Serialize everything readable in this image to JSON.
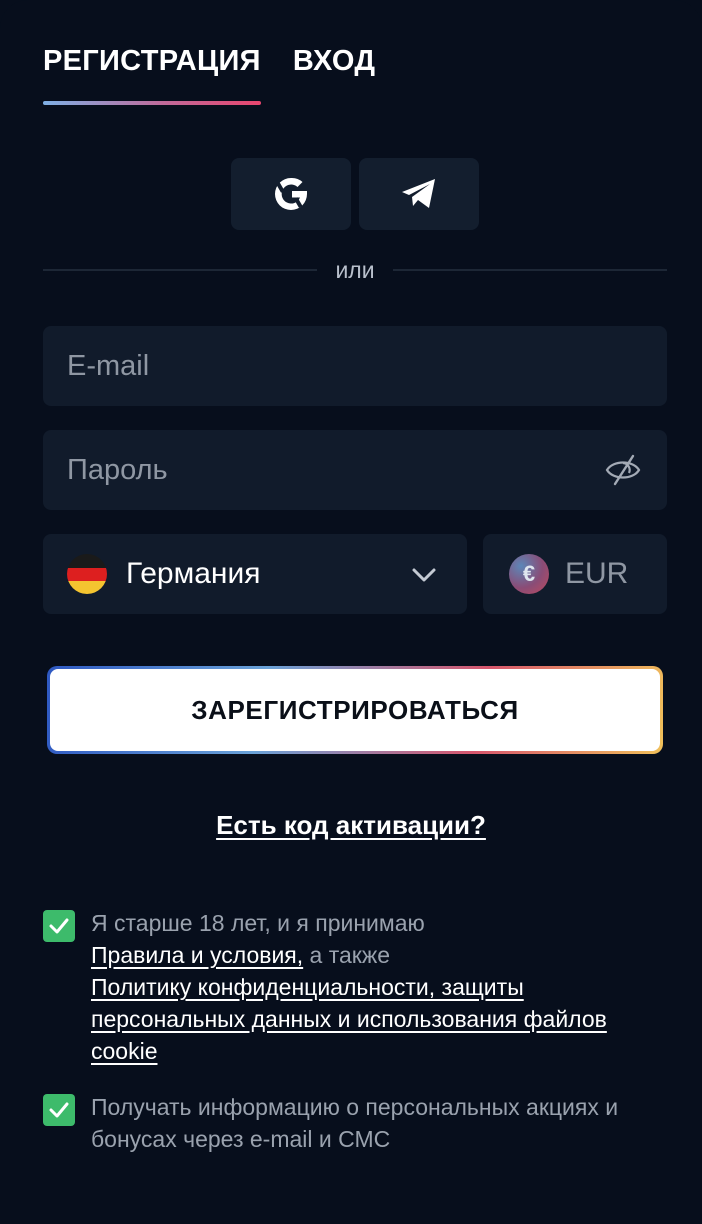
{
  "tabs": [
    {
      "label": "РЕГИСТРАЦИЯ",
      "active": true
    },
    {
      "label": "ВХОД",
      "active": false
    }
  ],
  "social": {
    "google_icon": "google-icon",
    "telegram_icon": "telegram-icon"
  },
  "divider_text": "или",
  "email": {
    "placeholder": "E-mail",
    "value": ""
  },
  "password": {
    "placeholder": "Пароль",
    "value": "",
    "eye_icon": "eye-off-icon"
  },
  "country": {
    "label": "Германия",
    "flag_icon": "germany-flag-icon"
  },
  "currency": {
    "label": "EUR",
    "symbol": "€"
  },
  "register_label": "ЗАРЕГИСТРИРОВАТЬСЯ",
  "activation_link": "Есть код активации?",
  "consent": {
    "line1": "Я старше 18 лет, и я принимаю",
    "terms_link": "Правила и условия,",
    "also": " а также",
    "privacy_link": "Политику конфиденциальности, защиты персональных данных и использования файлов cookie",
    "checked": true
  },
  "promo": {
    "text": "Получать информацию о персональных акциях и бонусах через e-mail и СМС",
    "checked": true
  },
  "colors": {
    "background": "#070e1c",
    "field": "#111b2b",
    "checkbox": "#3dbb6b",
    "tab_underline_end": "#e8456e"
  }
}
